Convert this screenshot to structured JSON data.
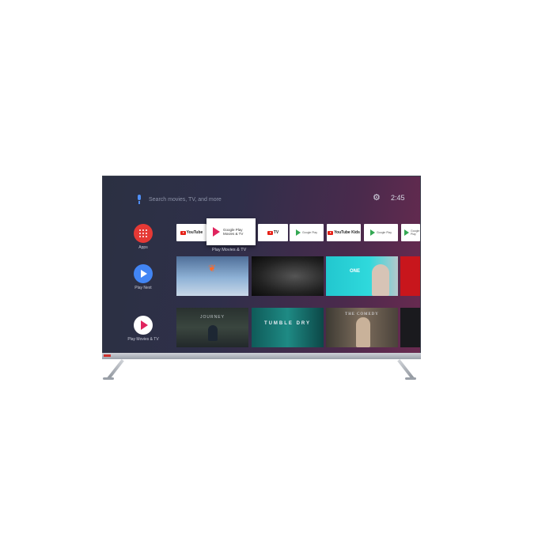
{
  "search": {
    "placeholder": "Search movies, TV, and more"
  },
  "status": {
    "time": "2:45",
    "settings_icon": "gear-icon"
  },
  "rail": [
    {
      "label": "Apps",
      "icon": "apps-grid-icon",
      "color": "#e53935"
    },
    {
      "label": "Play Next",
      "icon": "play-icon",
      "color": "#4285f4"
    },
    {
      "label": "Play Movies & TV",
      "icon": "play-movies-icon",
      "color": "#ffffff"
    }
  ],
  "apps_row": {
    "tiles": [
      {
        "label": "YouTube",
        "kind": "youtube"
      },
      {
        "label": "Google Play Movies & TV",
        "kind": "featured"
      },
      {
        "label": "TV",
        "kind": "youtube-tv"
      },
      {
        "label": "Google Play",
        "kind": "google-play"
      },
      {
        "label": "YouTube Kids",
        "kind": "youtube"
      },
      {
        "label": "Google Play",
        "kind": "google-play"
      },
      {
        "label": "Google Play",
        "kind": "google-play"
      }
    ],
    "featured": {
      "line1": "Google Play",
      "line2": "Movies & TV",
      "caption": "Play Movies & TV"
    }
  },
  "row1": {
    "tiles": [
      {
        "title": ""
      },
      {
        "title": ""
      },
      {
        "title": "ONE"
      },
      {
        "title": ""
      }
    ]
  },
  "row2": {
    "tiles": [
      {
        "title": "JOURNEY"
      },
      {
        "title": "TUMBLE DRY"
      },
      {
        "title": "THE COMEDY"
      },
      {
        "title": ""
      }
    ]
  }
}
